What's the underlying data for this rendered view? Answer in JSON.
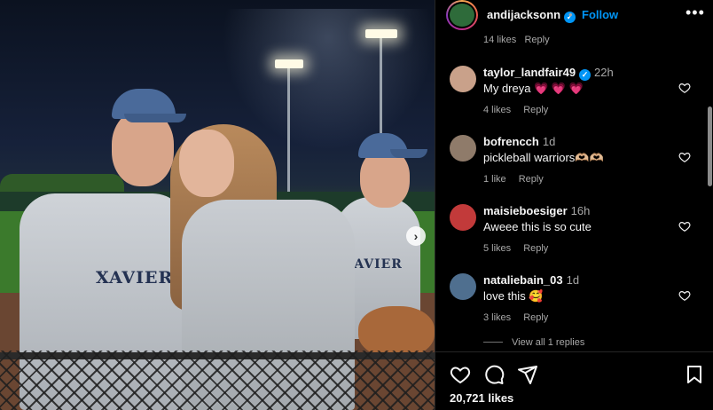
{
  "post": {
    "username": "andijacksonn",
    "follow_label": "Follow",
    "separator": "•",
    "likes_count": "20,721 likes"
  },
  "photo": {
    "jersey_text_1": "XAVIER",
    "jersey_text_2": "XAVIER",
    "next_glyph": "›"
  },
  "comments": {
    "previous_meta": "14 likes   Reply",
    "items": [
      {
        "user": "taylor_landfair49",
        "verified": true,
        "time": "22h",
        "text": "My dreya 💗 💗 💗",
        "likes": "4 likes",
        "reply": "Reply",
        "avatar_color": "#c9a18a"
      },
      {
        "user": "bofrencch",
        "verified": false,
        "time": "1d",
        "text": "pickleball warriors🫶🏼🫶🏼",
        "likes": "1 like",
        "reply": "Reply",
        "avatar_color": "#8f7b6a"
      },
      {
        "user": "maisieboesiger",
        "verified": false,
        "time": "16h",
        "text": "Aweee this is so cute",
        "likes": "5 likes",
        "reply": "Reply",
        "avatar_color": "#c23a3a"
      },
      {
        "user": "nataliebain_03",
        "verified": false,
        "time": "1d",
        "text": "love this 🥰",
        "likes": "3 likes",
        "reply": "Reply",
        "avatar_color": "#4f6f8f"
      }
    ],
    "view_replies": "View all 1 replies"
  },
  "icons": {
    "verified": "✓",
    "more": "•••"
  },
  "colors": {
    "accent": "#0095f6",
    "background": "#000000",
    "muted": "#a8a8a8"
  }
}
